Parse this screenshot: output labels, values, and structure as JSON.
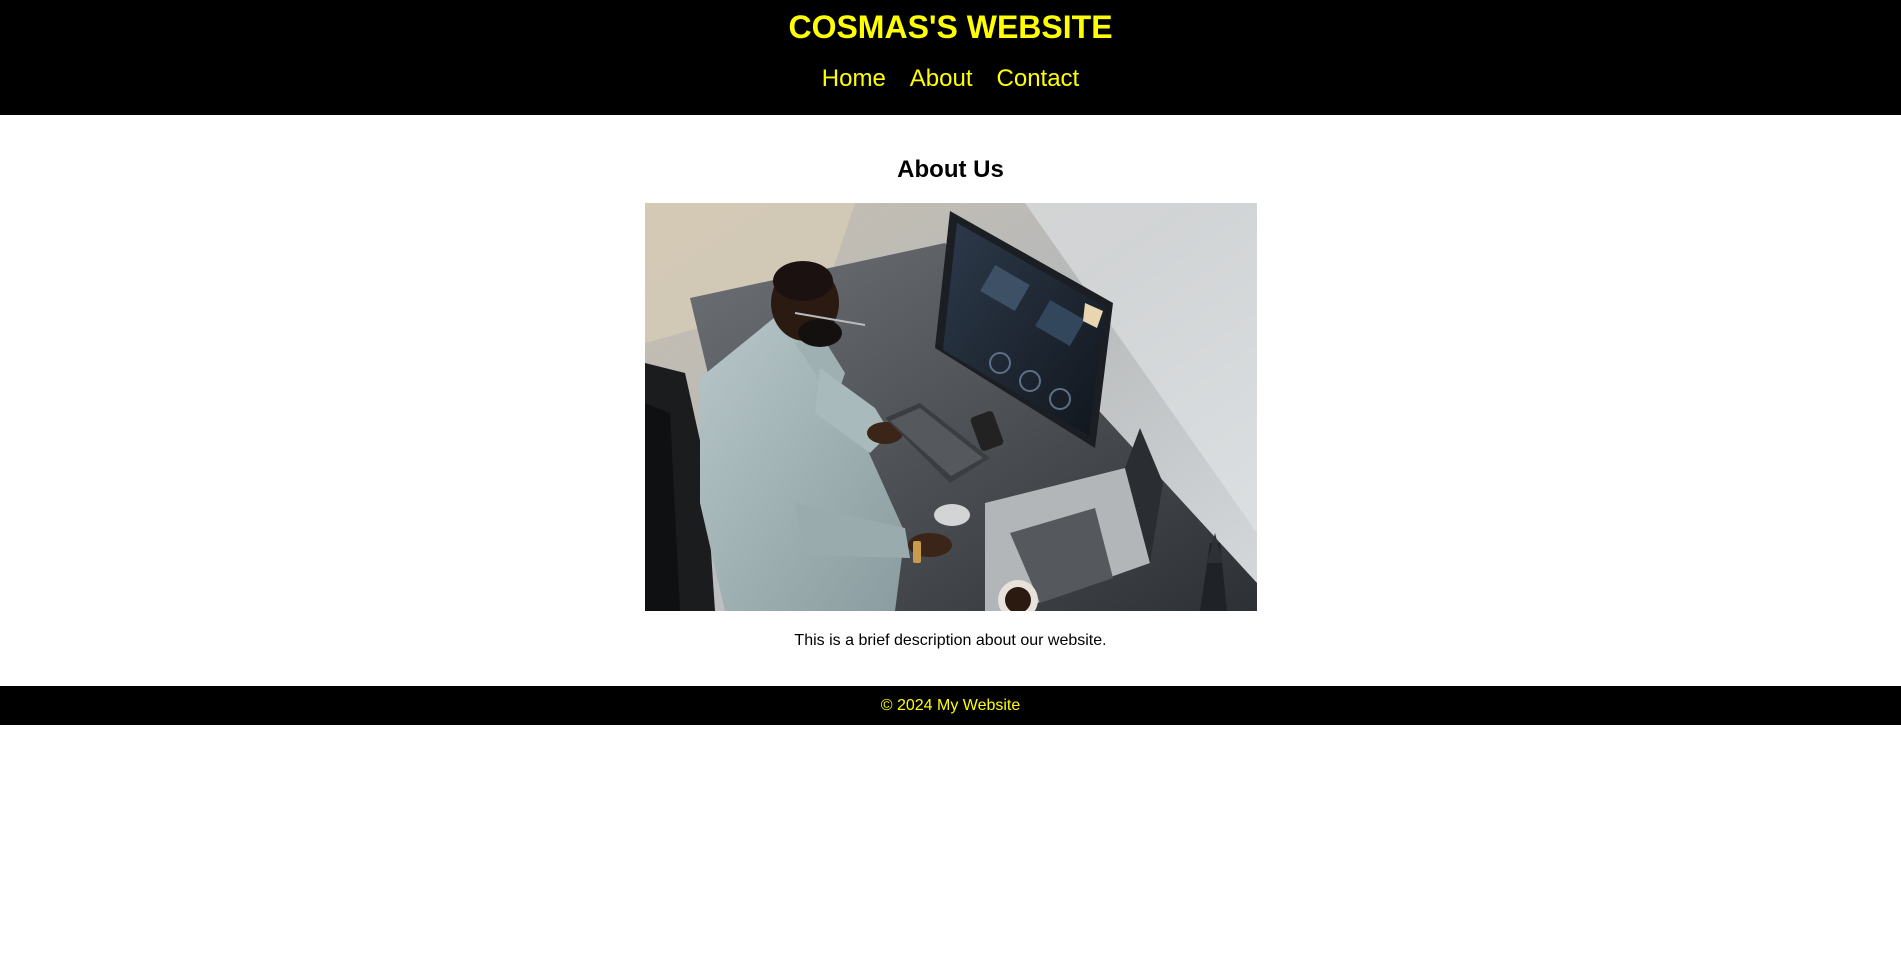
{
  "header": {
    "title": "COSMAS'S WEBSITE",
    "nav": [
      {
        "label": "Home"
      },
      {
        "label": "About"
      },
      {
        "label": "Contact"
      }
    ]
  },
  "main": {
    "heading": "About Us",
    "image": {
      "icon": "photo-man-working-at-computer-desk"
    },
    "description": "This is a brief description about our website."
  },
  "footer": {
    "text": "© 2024 My Website"
  },
  "colors": {
    "header_bg": "#000000",
    "accent": "#ffff00",
    "page_bg": "#ffffff"
  }
}
